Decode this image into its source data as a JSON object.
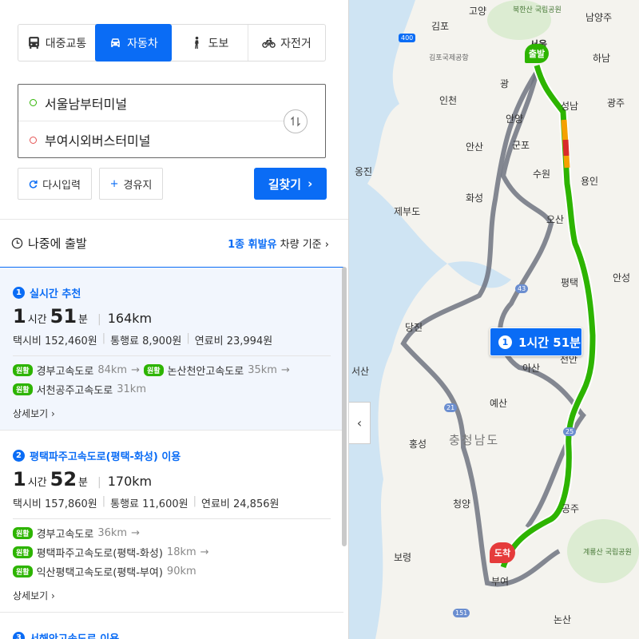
{
  "modes": [
    {
      "label": "대중교통",
      "icon": "bus-icon"
    },
    {
      "label": "자동차",
      "icon": "car-icon",
      "active": true
    },
    {
      "label": "도보",
      "icon": "walk-icon"
    },
    {
      "label": "자전거",
      "icon": "bicycle-icon"
    }
  ],
  "route": {
    "start": "서울남부터미널",
    "end": "부여시외버스터미널"
  },
  "buttons": {
    "reset": "다시입력",
    "via": "경유지",
    "find": "길찾기"
  },
  "options": {
    "depart_later": "나중에 출발",
    "fuel_type": "1종 휘발유",
    "fuel_suffix": "차량 기준"
  },
  "results": [
    {
      "num": "1",
      "title": "실시간 추천",
      "hours": "1",
      "hours_unit": "시간",
      "minutes": "51",
      "minutes_unit": "분",
      "distance": "164km",
      "taxi": "택시비 152,460원",
      "toll": "통행료 8,900원",
      "fuel": "연료비 23,994원",
      "roads": [
        {
          "tag": "원활",
          "name": "경부고속도로",
          "km": "84km"
        },
        {
          "tag": "원활",
          "name": "논산천안고속도로",
          "km": "35km"
        },
        {
          "tag": "원활",
          "name": "서천공주고속도로",
          "km": "31km"
        }
      ],
      "detail": "상세보기"
    },
    {
      "num": "2",
      "title": "평택파주고속도로(평택-화성) 이용",
      "hours": "1",
      "hours_unit": "시간",
      "minutes": "52",
      "minutes_unit": "분",
      "distance": "170km",
      "taxi": "택시비 157,860원",
      "toll": "통행료 11,600원",
      "fuel": "연료비 24,856원",
      "roads": [
        {
          "tag": "원활",
          "name": "경부고속도로",
          "km": "36km"
        },
        {
          "tag": "원활",
          "name": "평택파주고속도로(평택-화성)",
          "km": "18km"
        },
        {
          "tag": "원활",
          "name": "익산평택고속도로(평택-부여)",
          "km": "90km"
        }
      ],
      "detail": "상세보기"
    },
    {
      "num": "3",
      "title": "서해안고속도로 이용"
    }
  ],
  "map": {
    "badge_num": "1",
    "badge_text": "1시간 51분",
    "start_pin": "출발",
    "end_pin": "도착",
    "labels": [
      "고양",
      "김포",
      "서울",
      "남양주",
      "하남",
      "인천",
      "광",
      "성남",
      "광주",
      "안양",
      "안산",
      "군포",
      "옹진",
      "수원",
      "용인",
      "화성",
      "제부도",
      "오산",
      "평택",
      "안성",
      "당진",
      "아산",
      "천안",
      "서산",
      "예산",
      "홍성",
      "충청남도",
      "청양",
      "공주",
      "보령",
      "부여",
      "논산",
      "북한산 국립공원",
      "김포국제공항",
      "계룡산 국립공원"
    ],
    "shields": [
      "400",
      "43",
      "21",
      "25",
      "151"
    ],
    "colors": {
      "route_main": "#2db400",
      "route_alt": "#6e7380",
      "accent": "#0a6cf5",
      "pin": "#e53b3b"
    }
  }
}
